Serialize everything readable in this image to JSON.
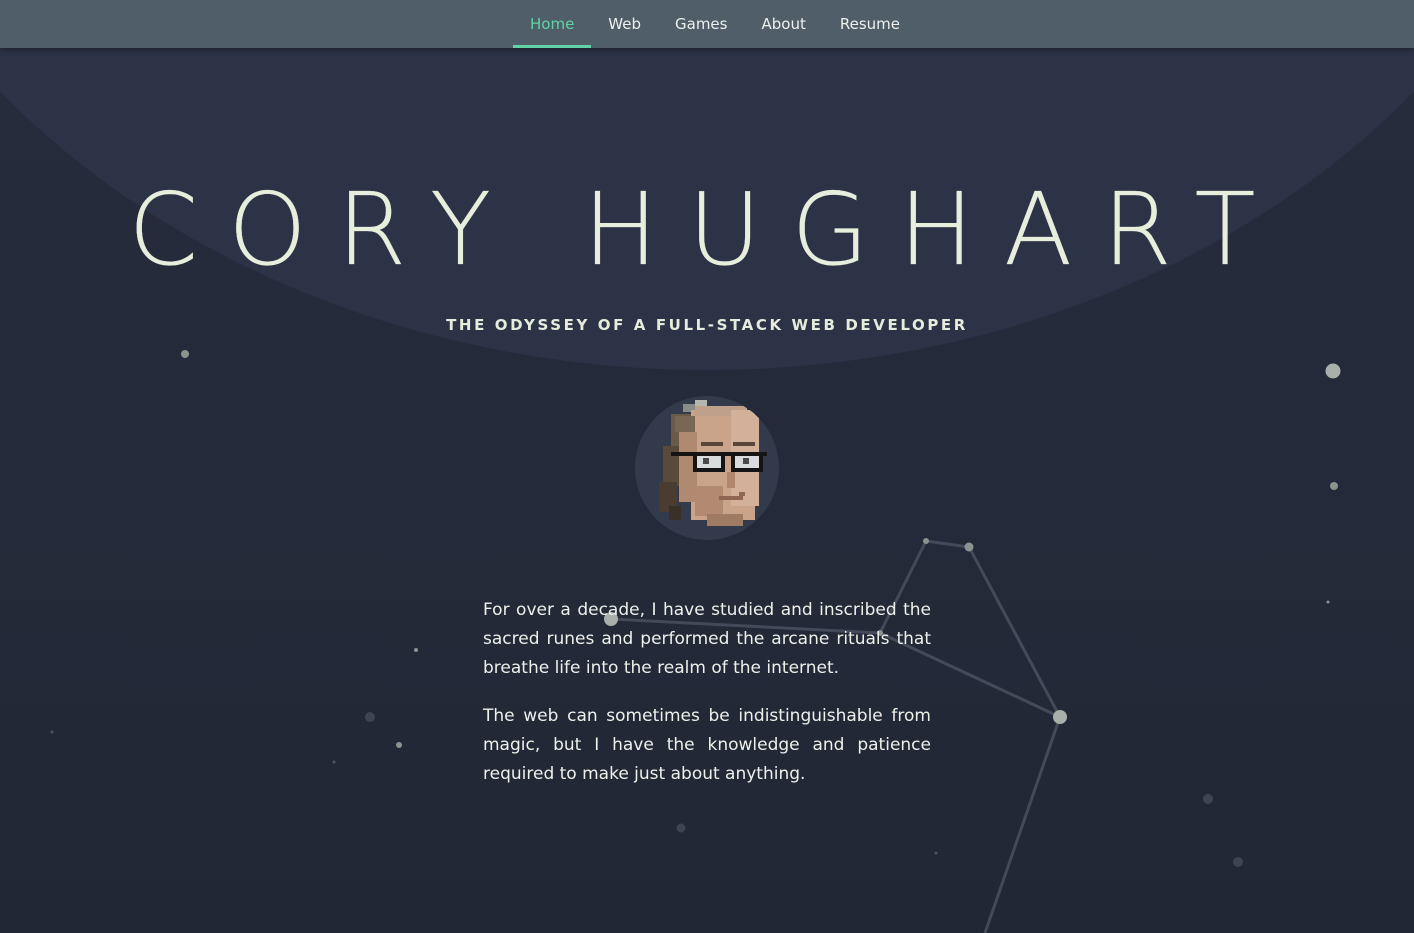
{
  "nav": {
    "items": [
      {
        "label": "Home",
        "active": true
      },
      {
        "label": "Web",
        "active": false
      },
      {
        "label": "Games",
        "active": false
      },
      {
        "label": "About",
        "active": false
      },
      {
        "label": "Resume",
        "active": false
      }
    ]
  },
  "hero": {
    "title": "CORY HUGHART",
    "subtitle": "THE ODYSSEY OF A FULL-STACK WEB DEVELOPER"
  },
  "avatar": {
    "icon": "pixel-art-portrait"
  },
  "bio": {
    "paragraphs": [
      "For over a decade, I have studied and inscribed the sacred runes and performed the arcane rituals that breathe life into the realm of the internet.",
      "The web can sometimes be indistinguishable from magic, but I have the knowledge and patience required to make just about anything."
    ]
  },
  "colors": {
    "accent": "#62d3a6",
    "nav_background": "#4f5e68",
    "background": "#242a39",
    "text": "#e8eedc"
  }
}
